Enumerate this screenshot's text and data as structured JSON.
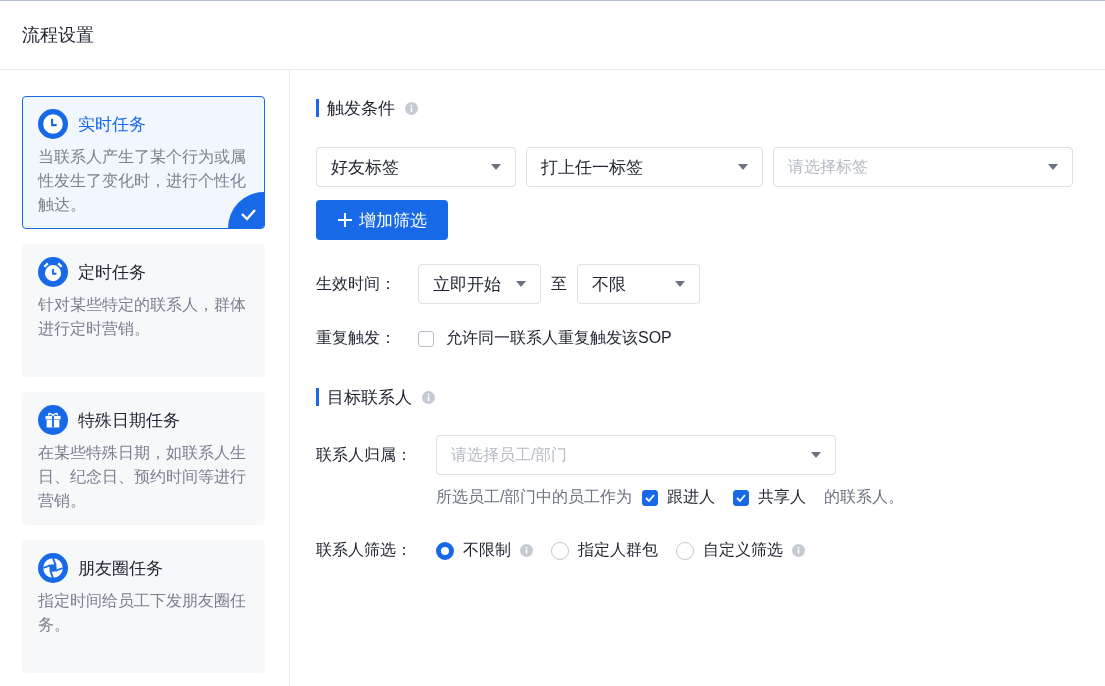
{
  "header": {
    "title": "流程设置"
  },
  "task_types": [
    {
      "kind": "clock",
      "title": "实时任务",
      "description": "当联系人产生了某个行为或属性发生了变化时，进行个性化触达。",
      "selected": true
    },
    {
      "kind": "alarm",
      "title": "定时任务",
      "description": "针对某些特定的联系人，群体进行定时营销。",
      "selected": false
    },
    {
      "kind": "gift",
      "title": "特殊日期任务",
      "description": "在某些特殊日期，如联系人生日、纪念日、预约时间等进行营销。",
      "selected": false
    },
    {
      "kind": "aperture",
      "title": "朋友圈任务",
      "description": "指定时间给员工下发朋友圈任务。",
      "selected": false
    }
  ],
  "trigger": {
    "title": "触发条件",
    "filters": [
      {
        "value": "好友标签"
      },
      {
        "value": "打上任一标签"
      },
      {
        "placeholder": "请选择标签"
      }
    ],
    "add_button": "增加筛选",
    "effective_time": {
      "label": "生效时间：",
      "start": "立即开始",
      "separator": "至",
      "end": "不限"
    },
    "repeat": {
      "label": "重复触发：",
      "option": "允许同一联系人重复触发该SOP",
      "checked": false
    }
  },
  "target": {
    "title": "目标联系人",
    "owner": {
      "label": "联系人归属：",
      "placeholder": "请选择员工/部门"
    },
    "role_line": {
      "prefix": "所选员工/部门中的员工作为",
      "options": [
        {
          "label": "跟进人",
          "checked": true
        },
        {
          "label": "共享人",
          "checked": true
        }
      ],
      "suffix": "的联系人。"
    },
    "filter": {
      "label": "联系人筛选：",
      "options": [
        {
          "label": "不限制",
          "selected": true,
          "info": true
        },
        {
          "label": "指定人群包",
          "selected": false,
          "info": false
        },
        {
          "label": "自定义筛选",
          "selected": false,
          "info": true
        }
      ]
    }
  }
}
